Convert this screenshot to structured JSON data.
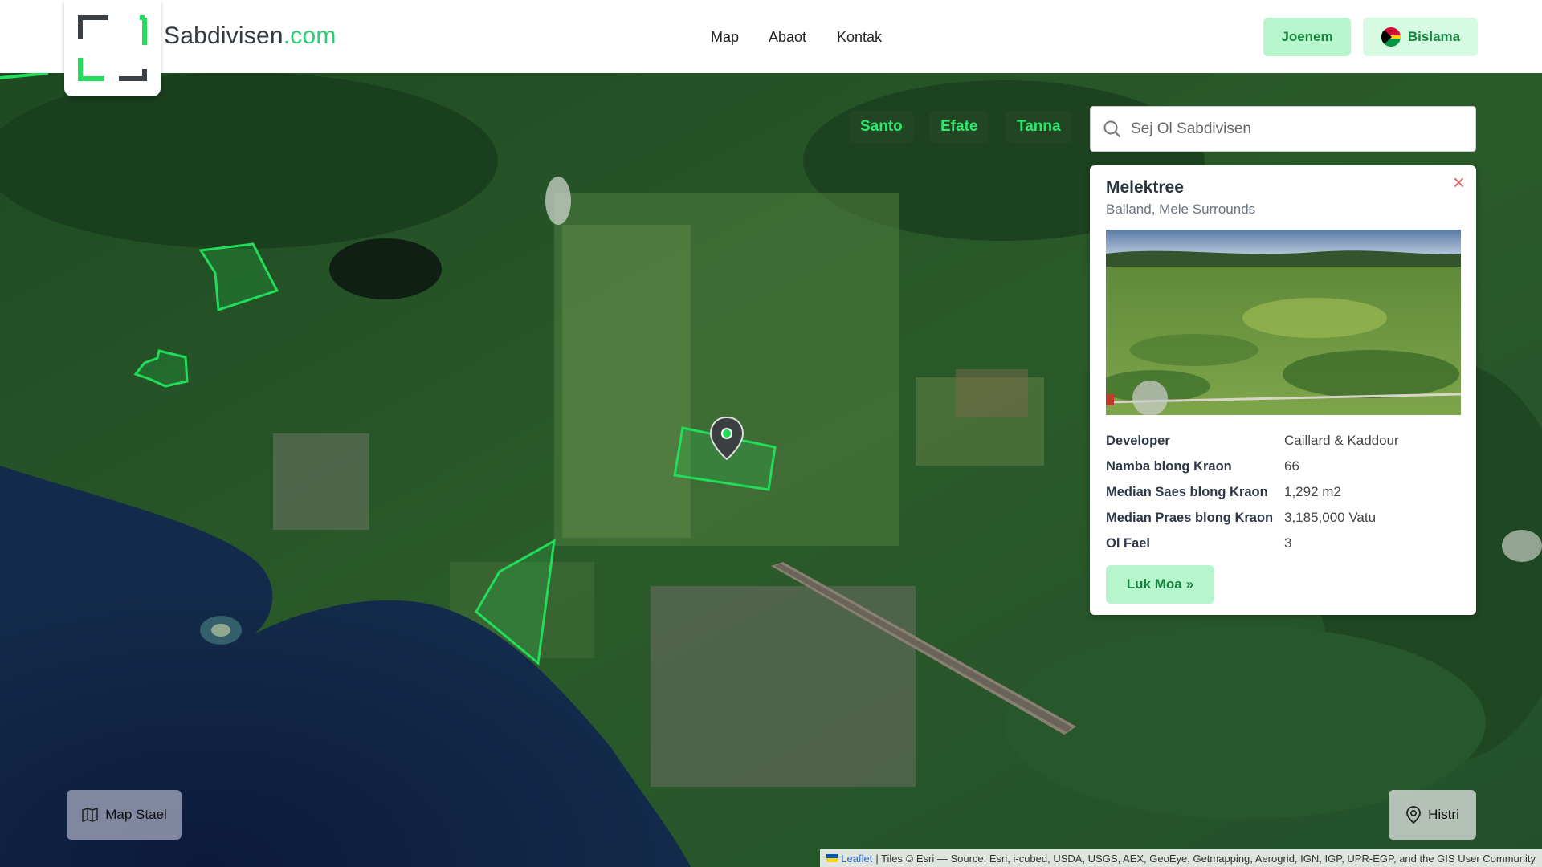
{
  "header": {
    "brand_name": "Sabdivisen",
    "brand_tld": ".com",
    "nav": [
      {
        "label": "Map"
      },
      {
        "label": "Abaot"
      },
      {
        "label": "Kontak"
      }
    ],
    "join_label": "Joenem",
    "language_label": "Bislama"
  },
  "map": {
    "islands": [
      {
        "label": "Santo"
      },
      {
        "label": "Efate"
      },
      {
        "label": "Tanna"
      }
    ],
    "search": {
      "placeholder": "Sej Ol Sabdivisen"
    },
    "map_style_label": "Map Stael",
    "history_label": "Histri",
    "attribution": {
      "leaflet": "Leaflet",
      "rest": "| Tiles © Esri — Source: Esri, i-cubed, USDA, USGS, AEX, GeoEye, Getmapping, Aerogrid, IGN, IGP, UPR-EGP, and the GIS User Community"
    },
    "colors": {
      "parcel_outline": "#22dd5a",
      "accent": "#2ecc71"
    }
  },
  "panel": {
    "title": "Melektree",
    "subtitle": "Balland, Mele Surrounds",
    "rows": [
      {
        "key": "Developer",
        "value": "Caillard & Kaddour"
      },
      {
        "key": "Namba blong Kraon",
        "value": "66"
      },
      {
        "key": "Median Saes blong Kraon",
        "value": "1,292 m2"
      },
      {
        "key": "Median Praes blong Kraon",
        "value": "3,185,000 Vatu"
      },
      {
        "key": "Ol Fael",
        "value": "3"
      }
    ],
    "more_label": "Luk Moa"
  }
}
